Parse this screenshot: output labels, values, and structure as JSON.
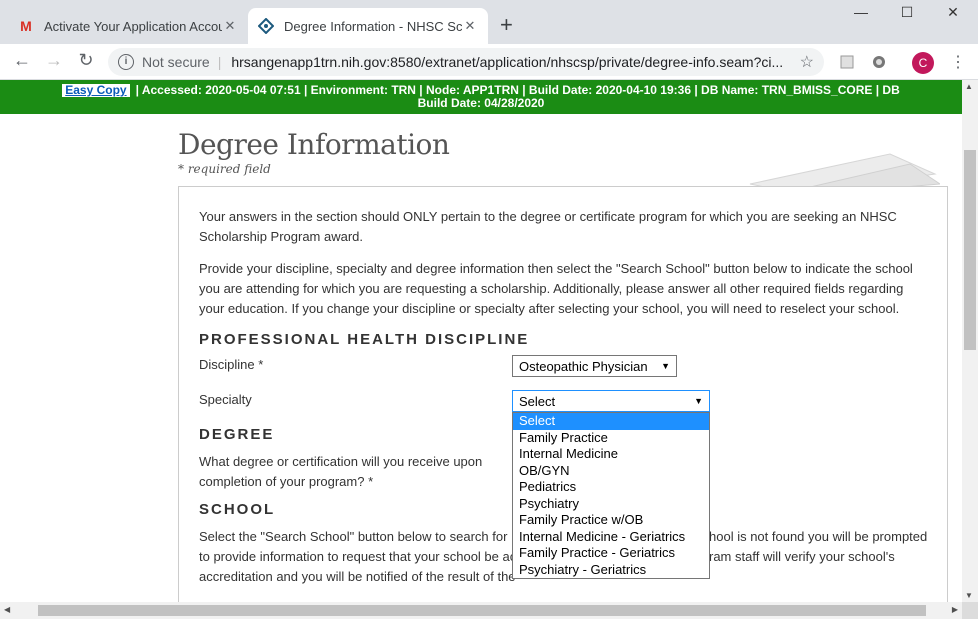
{
  "browser": {
    "tabs": [
      {
        "title": "Activate Your Application Accou",
        "close": "✕"
      },
      {
        "title": "Degree Information - NHSC Scho",
        "close": "✕"
      }
    ],
    "new_tab": "+",
    "window": {
      "minimize": "—",
      "maximize": "☐",
      "close": "✕"
    },
    "nav": {
      "back": "←",
      "forward": "→",
      "reload": "↻"
    },
    "security": "Not secure",
    "url": "hrsangenapp1trn.nih.gov:8580/extranet/application/nhscsp/private/degree-info.seam?ci...",
    "star": "☆",
    "avatar": "C",
    "menu": "⋮"
  },
  "env_bar": {
    "easy_copy": "Easy Copy",
    "line1": "|    Accessed: 2020-05-04 07:51    |    Environment: TRN    |    Node: APP1TRN    |    Build Date: 2020-04-10 19:36    |    DB Name: TRN_BMISS_CORE    |    DB",
    "line2": "Build Date: 04/28/2020"
  },
  "page": {
    "title": "Degree Information",
    "required_note": "* required field",
    "intro1": "Your answers in the section should ONLY pertain to the degree or certificate program for which you are seeking an NHSC Scholarship Program award.",
    "intro2": "Provide your discipline, specialty and degree information then select the \"Search School\" button below to indicate the school you are attending for which you are requesting a scholarship. Additionally, please answer all other required fields regarding your education. If you change your discipline or specialty after selecting your school, you will need to reselect your school.",
    "sections": {
      "discipline": "PROFESSIONAL HEALTH DISCIPLINE",
      "degree": "DEGREE",
      "school": "SCHOOL"
    },
    "discipline_label": "Discipline *",
    "discipline_value": "Osteopathic Physician",
    "specialty_label": "Specialty",
    "specialty_value": "Select",
    "degree_question_1": "What degree or certification will you receive upon",
    "degree_question_2": "completion of your program? *",
    "school_text_1": "Select the \"Search School\" button below to search for",
    "school_text_1b": "hool is not found you will be prompted",
    "school_text_2": "to provide information to request that your school be ac",
    "school_text_2b": "ram staff will verify your school's",
    "school_text_3": "accreditation and you will be notified of the result of the",
    "specialty_options": [
      "Select",
      "Family Practice",
      "Internal Medicine",
      "OB/GYN",
      "Pediatrics",
      "Psychiatry",
      "Family Practice w/OB",
      "Internal Medicine - Geriatrics",
      "Family Practice - Geriatrics",
      "Psychiatry - Geriatrics"
    ]
  },
  "colors": {
    "env_bar": "#1b8c14",
    "selected_option": "#1e90ff",
    "gmail_red": "#d93025",
    "avatar": "#c2185b"
  }
}
